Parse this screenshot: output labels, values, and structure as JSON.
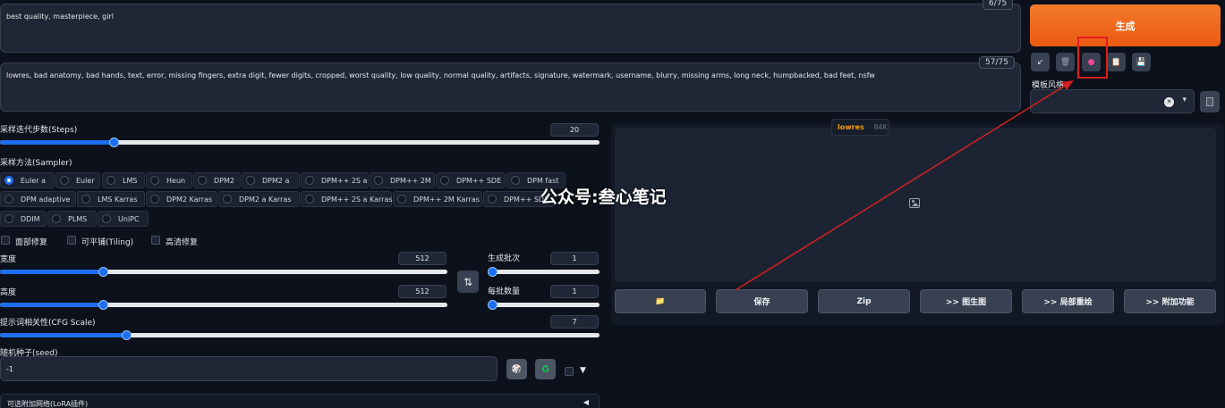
{
  "prompt": {
    "text": "best quality, masterpiece, girl",
    "counter": "6/75"
  },
  "negative_prompt": {
    "text": "lowres, bad anatomy, bad hands, text, error, missing fingers, extra digit, fewer digits, cropped, worst quality, low quality, normal quality, artifacts, signature, watermark, username, blurry, missing arms, long neck, humpbacked, bad feet, nsfw",
    "counter": "57/75"
  },
  "generate_label": "生成",
  "tools": {
    "arrow": "↙",
    "trash": "🗑",
    "extra": "●",
    "paste": "📋",
    "save": "💾"
  },
  "style": {
    "label": "模板风格",
    "clear": "✕",
    "caret": "▾"
  },
  "steps": {
    "label": "采样迭代步数(Steps)",
    "value": "20",
    "fraction": 0.19
  },
  "sampler": {
    "label": "采样方法(Sampler)",
    "options": [
      "Euler a",
      "Euler",
      "LMS",
      "Heun",
      "DPM2",
      "DPM2 a",
      "DPM++ 2S a",
      "DPM++ 2M",
      "DPM++ SDE",
      "DPM fast",
      "DPM adaptive",
      "LMS Karras",
      "DPM2 Karras",
      "DPM2 a Karras",
      "DPM++ 2S a Karras",
      "DPM++ 2M Karras",
      "DPM++ SDE Karras",
      "DDIM",
      "PLMS",
      "UniPC"
    ],
    "visible_labels": [
      "Euler a",
      "Euler",
      "LMS",
      "Heun",
      "DPM2",
      "DPM2 a",
      "DPM++ 2S a",
      "DPM++ 2M",
      "DPM++ SDE",
      "DPM fast",
      "DPM adaptive",
      "LMS Karras",
      "DPM2 Karras",
      "DPM2 a Karras",
      "DPM++ 2S a Karras",
      "DPM++ 2M Karras",
      "DPM++ SDE",
      "DDIM",
      "PLMS",
      "UniPC"
    ],
    "selected": "Euler a"
  },
  "checks": {
    "face_restore": "面部修复",
    "tiling": "可平铺(Tiling)",
    "hires": "高清修复"
  },
  "width": {
    "label": "宽度",
    "value": "512",
    "fraction": 0.23
  },
  "height": {
    "label": "高度",
    "value": "512",
    "fraction": 0.23
  },
  "swap_icon": "⇅",
  "batch_count": {
    "label": "生成批次",
    "value": "1",
    "fraction": 0.0
  },
  "batch_size": {
    "label": "每批数量",
    "value": "1",
    "fraction": 0.0
  },
  "cfg": {
    "label": "提示词相关性(CFG Scale)",
    "value": "7",
    "fraction": 0.21
  },
  "seed": {
    "label": "随机种子(seed)",
    "value": "-1",
    "dice": "🎲",
    "recycle": "♻",
    "extra": "▼"
  },
  "lora": {
    "label": "可选附加网络(LoRA插件)",
    "arrow": "◀"
  },
  "output": {
    "tab_label": "lowres",
    "tab_size": "84K",
    "image_icon": "🖼"
  },
  "actions": {
    "folder": "📁",
    "save": "保存",
    "zip": "Zip",
    "img2img": ">> 图生图",
    "inpaint": ">> 局部重绘",
    "extras": ">> 附加功能"
  },
  "watermark": "公众号:叁心笔记",
  "colors": {
    "accent": "#1d6ff0",
    "generate": "#f2651c",
    "annotation": "#e01e1e",
    "tab_label": "#f59e0b"
  }
}
